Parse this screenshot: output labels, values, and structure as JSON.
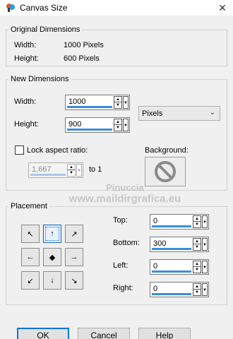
{
  "window": {
    "title": "Canvas Size",
    "close_glyph": "✕",
    "app_icon": "pfs-app-icon"
  },
  "original": {
    "group_title": "Original Dimensions",
    "width_label": "Width:",
    "width_value": "1000 Pixels",
    "height_label": "Height:",
    "height_value": "600 Pixels"
  },
  "new_dims": {
    "group_title": "New Dimensions",
    "width_label": "Width:",
    "width_value": "1000",
    "height_label": "Height:",
    "height_value": "900",
    "units": "Pixels",
    "lock_label": "Lock aspect ratio:",
    "ratio_value": "1,667",
    "ratio_suffix": "to 1",
    "background_label": "Background:"
  },
  "placement": {
    "group_title": "Placement",
    "top_label": "Top:",
    "top_value": "0",
    "bottom_label": "Bottom:",
    "bottom_value": "300",
    "left_label": "Left:",
    "left_value": "0",
    "right_label": "Right:",
    "right_value": "0",
    "grid_glyphs": [
      "↖",
      "↑",
      "↗",
      "←",
      "◆",
      "→",
      "↙",
      "↓",
      "↘"
    ],
    "selected_index": 1
  },
  "buttons": {
    "ok": "OK",
    "cancel": "Cancel",
    "help": "Help"
  },
  "spin_up": "▲",
  "spin_down": "▼",
  "dropdown_glyph": "▼",
  "chevron": "⌄",
  "watermark": {
    "line1": "Pinuccia",
    "line2": "www.maildirgrafica.eu"
  },
  "colors": {
    "accent": "#3c8dde",
    "default_button_border": "#0078d7"
  }
}
